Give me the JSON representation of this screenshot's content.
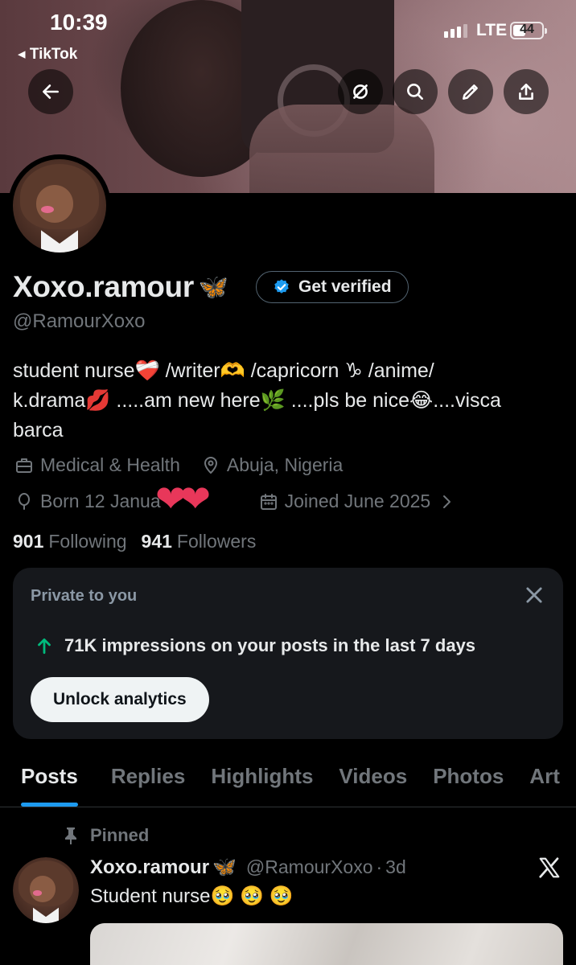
{
  "status_bar": {
    "time": "10:39",
    "back_app": "◂ TikTok",
    "network": "LTE",
    "battery": "44"
  },
  "header_actions": {
    "back_icon": "arrow-left-icon",
    "grok_icon": "grok-icon",
    "search_icon": "search-icon",
    "edit_icon": "pencil-icon",
    "share_icon": "share-icon"
  },
  "profile": {
    "display_name": "Xoxo.ramour",
    "name_emoji": "🦋",
    "get_verified_label": "Get verified",
    "handle": "@RamourXoxo",
    "bio_line1": "student nurse❤️‍🩹 /writer🫶 /capricorn ♑ /anime/",
    "bio_line2": "k.drama💋 .....am new here🌿 ....pls be nice😂....visca",
    "bio_line3": "barca",
    "category": "Medical & Health",
    "location": "Abuja, Nigeria",
    "born": "Born 12 Janua",
    "born_overlay": "❤❤",
    "joined": "Joined June 2025",
    "following_count": "901",
    "following_label": "Following",
    "followers_count": "941",
    "followers_label": "Followers"
  },
  "analytics_card": {
    "title": "Private to you",
    "stat_text": "71K impressions on your posts in the last 7 days",
    "button_label": "Unlock analytics"
  },
  "tabs": [
    "Posts",
    "Replies",
    "Highlights",
    "Videos",
    "Photos",
    "Art"
  ],
  "active_tab": "Posts",
  "pinned_post": {
    "pinned_label": "Pinned",
    "author_name": "Xoxo.ramour",
    "author_emoji": "🦋",
    "author_handle": "@RamourXoxo",
    "separator": "·",
    "time": "3d",
    "text": "Student nurse🥹 🥹 🥹"
  },
  "colors": {
    "accent": "#1d9bf0",
    "background": "#000000",
    "secondary_text": "#71767b",
    "positive": "#00ba7c"
  }
}
